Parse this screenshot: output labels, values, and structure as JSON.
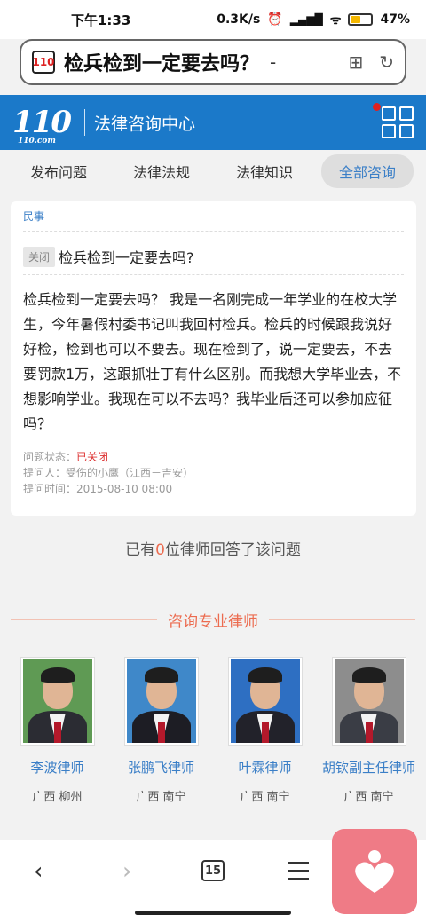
{
  "status_bar": {
    "time": "下午1:33",
    "net_speed": "0.3K/s",
    "battery": "47%"
  },
  "browser": {
    "page_title": "检兵检到一定要去吗？",
    "dash": "-",
    "site_icon_text": "110",
    "tab_count": "15"
  },
  "header": {
    "logo_text": "110",
    "logo_sub": "110.com",
    "title": "法律咨询中心"
  },
  "nav": {
    "tabs": [
      "发布问题",
      "法律法规",
      "法律知识",
      "全部咨询"
    ],
    "active_index": 3
  },
  "question": {
    "category": "民事",
    "closed_tag": "关闭",
    "title": "检兵检到一定要去吗?",
    "body": "检兵检到一定要去吗？ 我是一名刚完成一年学业的在校大学生，今年暑假村委书记叫我回村检兵。检兵的时候跟我说好好检，检到也可以不要去。现在检到了，说一定要去，不去要罚款1万，这跟抓壮丁有什么区别。而我想大学毕业去，不想影响学业。我现在可以不去吗？我毕业后还可以参加应征吗？",
    "status_label": "问题状态：",
    "status_value": "已关闭",
    "asker": "提问人：受伤的小鹰（江西－吉安）",
    "time": "提问时间：2015-08-10 08:00"
  },
  "answered": {
    "prefix": "已有",
    "count": "0",
    "suffix": "位律师回答了该问题"
  },
  "consult": {
    "title": "咨询专业律师"
  },
  "lawyers": [
    {
      "name": "李波律师",
      "location": "广西 柳州",
      "bg": "#5f9a54",
      "suit": "#2b2c33"
    },
    {
      "name": "张鹏飞律师",
      "location": "广西 南宁",
      "bg": "#3f88c9",
      "suit": "#1d1d24"
    },
    {
      "name": "叶霖律师",
      "location": "广西 南宁",
      "bg": "#2e6fc2",
      "suit": "#22222a"
    },
    {
      "name": "胡钦副主任律师",
      "location": "广西 南宁",
      "bg": "#8d8d8d",
      "suit": "#3a3d45"
    }
  ],
  "colors": {
    "brand_blue": "#1b79c9",
    "accent_orange": "#ec6b4f",
    "link_blue": "#3b7fc7"
  }
}
